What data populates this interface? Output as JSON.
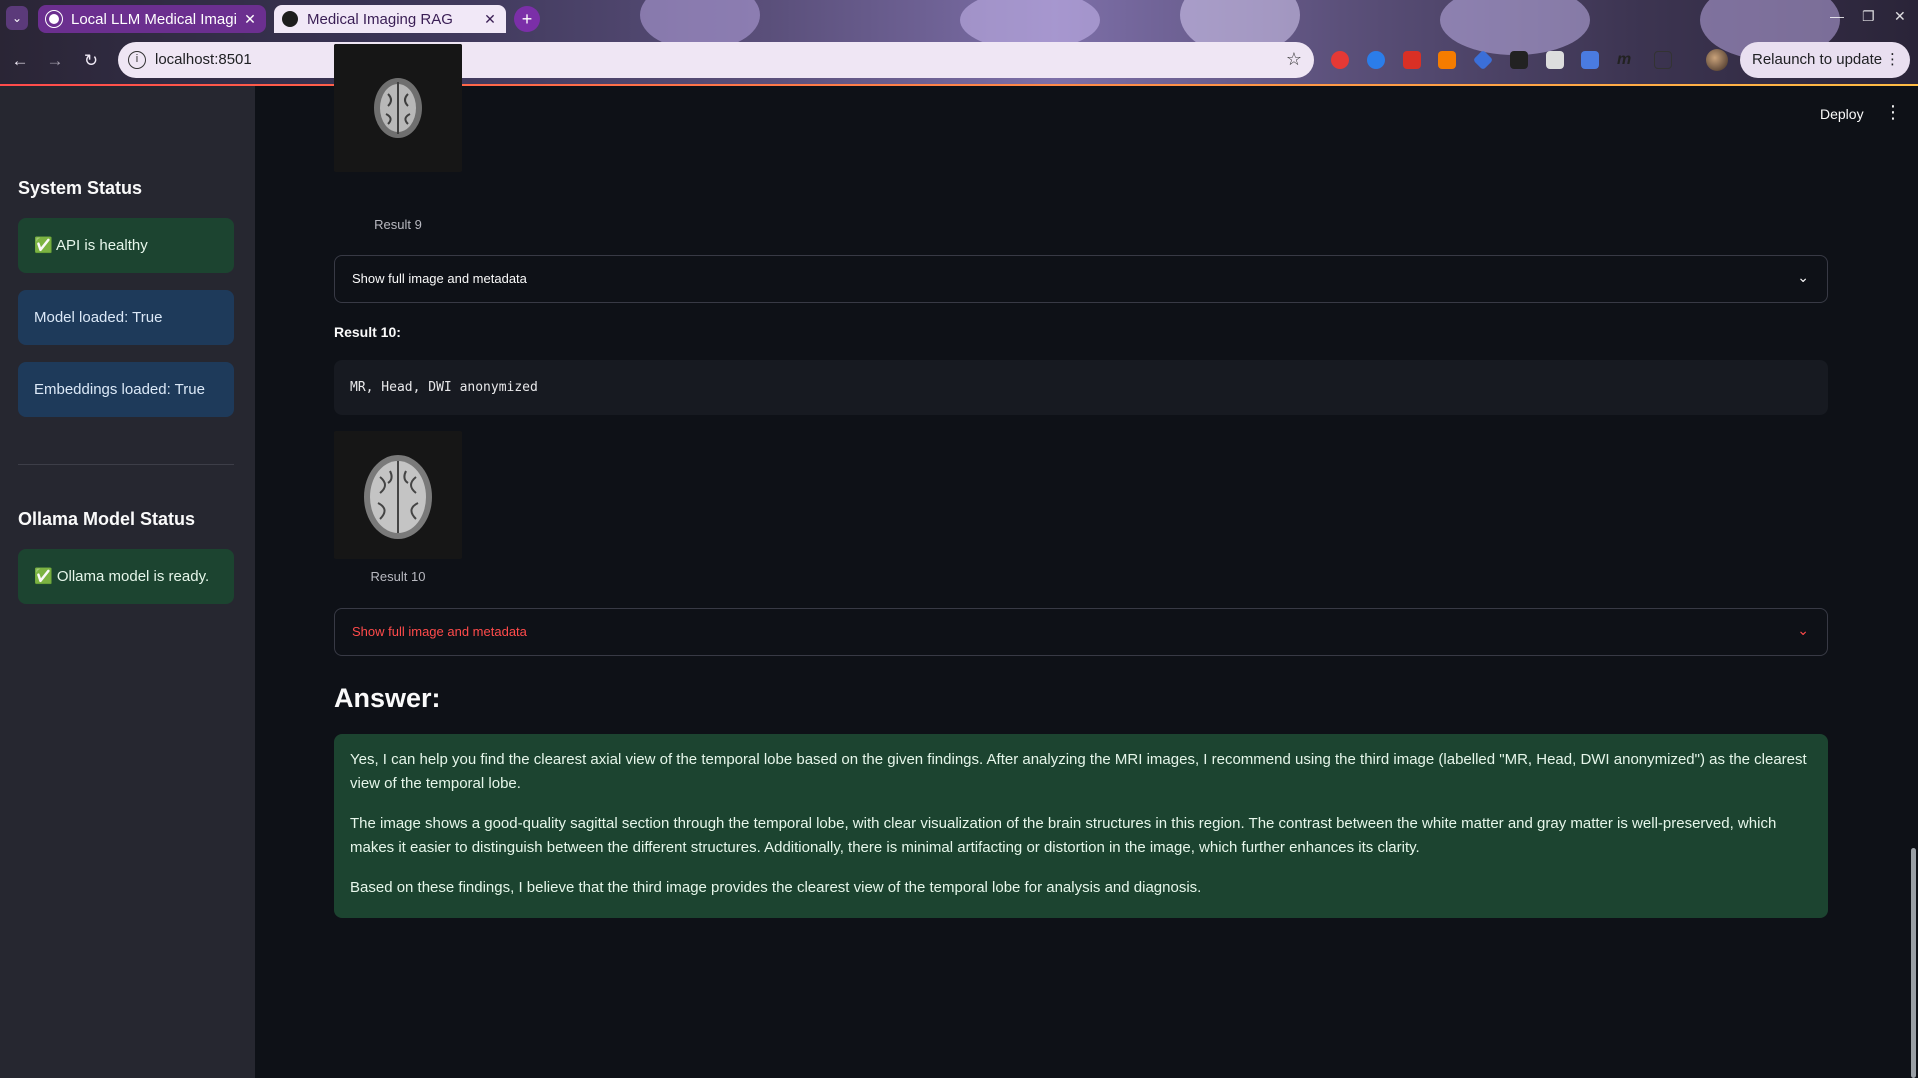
{
  "browser": {
    "tabs": [
      {
        "title": "Local LLM Medical Imagi",
        "active": false
      },
      {
        "title": "Medical Imaging RAG",
        "active": true
      }
    ],
    "url": "localhost:8501",
    "relaunch_label": "Relaunch to update"
  },
  "header": {
    "deploy_label": "Deploy"
  },
  "sidebar": {
    "system_status_title": "System Status",
    "api_status": "✅ API is healthy",
    "model_status": "Model loaded: True",
    "embeddings_status": "Embeddings loaded: True",
    "ollama_title": "Ollama Model Status",
    "ollama_status": "✅ Ollama model is ready."
  },
  "results": [
    {
      "caption": "Result 9",
      "expander_label": "Show full image and metadata"
    },
    {
      "heading": "Result 10:",
      "metadata": "MR, Head, DWI anonymized",
      "caption": "Result 10",
      "expander_label": "Show full image and metadata"
    }
  ],
  "answer": {
    "heading": "Answer:",
    "paragraphs": [
      "Yes, I can help you find the clearest axial view of the temporal lobe based on the given findings. After analyzing the MRI images, I recommend using the third image (labelled \"MR, Head, DWI anonymized\") as the clearest view of the temporal lobe.",
      "The image shows a good-quality sagittal section through the temporal lobe, with clear visualization of the brain structures in this region. The contrast between the white matter and gray matter is well-preserved, which makes it easier to distinguish between the different structures. Additionally, there is minimal artifacting or distortion in the image, which further enhances its clarity.",
      "Based on these findings, I believe that the third image provides the clearest view of the temporal lobe for analysis and diagnosis."
    ],
    "background_color": "#1c4430"
  },
  "colors": {
    "app_bg": "#0e1117",
    "sidebar_bg": "#262730",
    "accent_red": "#ff4b4b"
  }
}
